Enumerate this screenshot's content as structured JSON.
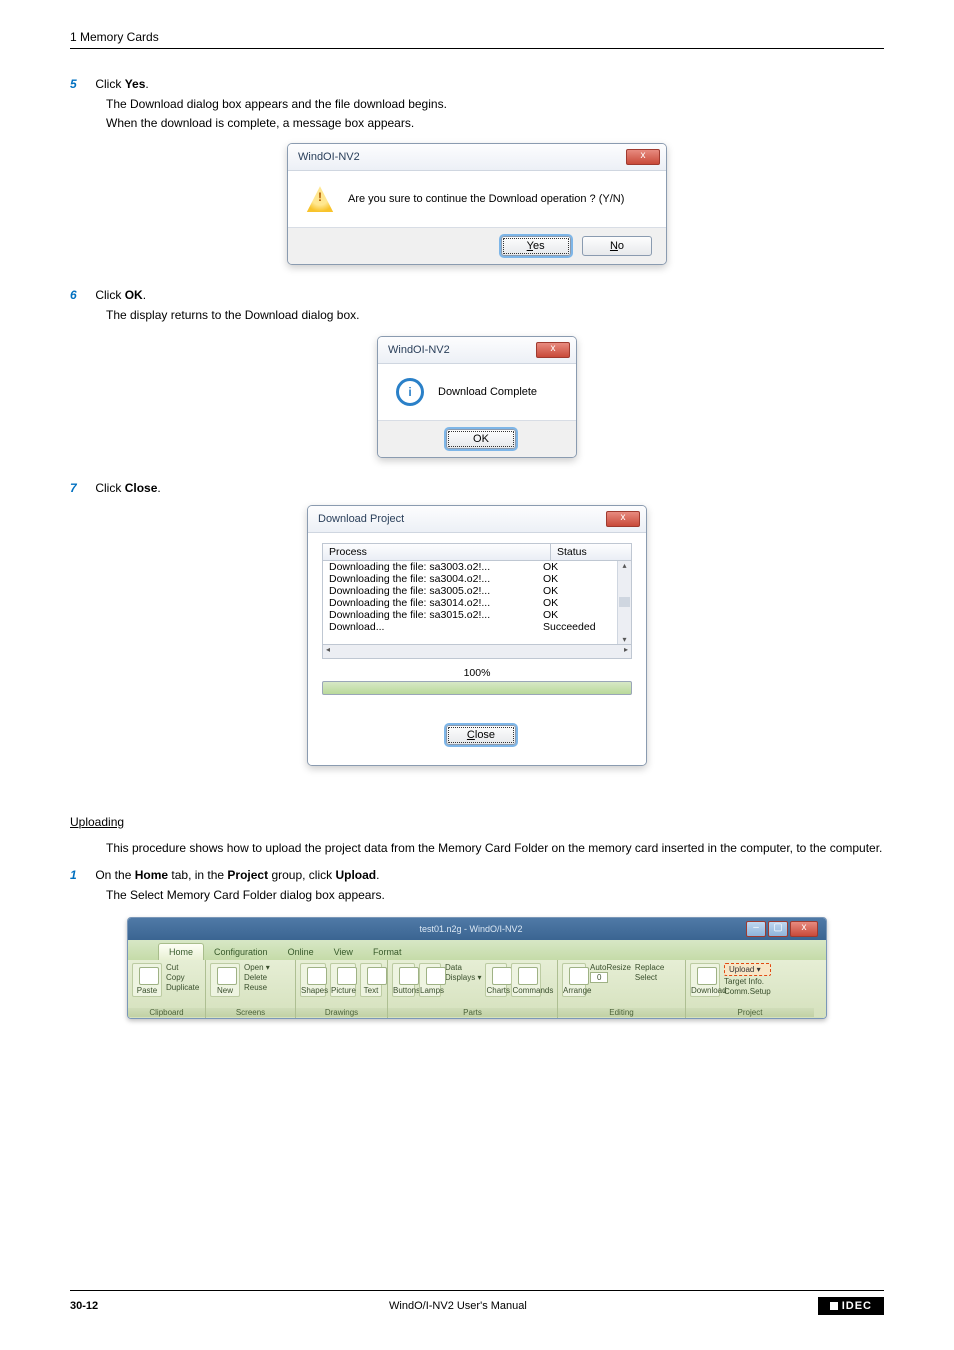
{
  "header": {
    "section": "1 Memory Cards"
  },
  "step5": {
    "num": "5",
    "text_prefix": "Click ",
    "text_bold": "Yes",
    "text_suffix": ".",
    "desc1": "The Download dialog box appears and the file download begins.",
    "desc2": "When the download is complete, a message box appears."
  },
  "dlg1": {
    "title": "WindOI-NV2",
    "msg": "Are you sure to continue the Download operation ? (Y/N)",
    "yes_u": "Y",
    "yes_rest": "es",
    "no_u": "N",
    "no_rest": "o"
  },
  "step6": {
    "num": "6",
    "text_prefix": "Click ",
    "text_bold": "OK",
    "text_suffix": ".",
    "desc1": "The display returns to the Download dialog box."
  },
  "dlg2": {
    "title": "WindOI-NV2",
    "msg": "Download Complete",
    "ok": "OK"
  },
  "step7": {
    "num": "7",
    "text_prefix": "Click ",
    "text_bold": "Close",
    "text_suffix": "."
  },
  "dlg3": {
    "title": "Download Project",
    "col_process": "Process",
    "col_status": "Status",
    "rows": [
      {
        "p": "Downloading the file: sa3003.o2!...",
        "s": "OK"
      },
      {
        "p": "Downloading the file: sa3004.o2!...",
        "s": "OK"
      },
      {
        "p": "Downloading the file: sa3005.o2!...",
        "s": "OK"
      },
      {
        "p": "Downloading the file: sa3014.o2!...",
        "s": "OK"
      },
      {
        "p": "Downloading the file: sa3015.o2!...",
        "s": "OK"
      },
      {
        "p": "Download...",
        "s": "Succeeded"
      }
    ],
    "pct": "100%",
    "close_u": "C",
    "close_rest": "lose"
  },
  "upload": {
    "heading": "Uploading",
    "intro": "This procedure shows how to upload the project data from the Memory Card Folder on the memory card inserted in the computer, to the computer.",
    "step1_num": "1",
    "step1_a": "On the ",
    "step1_b": "Home",
    "step1_c": " tab, in the ",
    "step1_d": "Project",
    "step1_e": " group, click ",
    "step1_f": "Upload",
    "step1_g": ".",
    "step1_desc": "The Select Memory Card Folder dialog box appears."
  },
  "ribbon": {
    "wintitle": "test01.n2g - WindO/I-NV2",
    "tabs": {
      "home": "Home",
      "config": "Configuration",
      "online": "Online",
      "view": "View",
      "format": "Format"
    },
    "groups": {
      "clipboard": "Clipboard",
      "screens": "Screens",
      "drawings": "Drawings",
      "parts": "Parts",
      "editing": "Editing",
      "project": "Project"
    },
    "items": {
      "paste": "Paste",
      "cut": "Cut",
      "copy": "Copy",
      "duplicate": "Duplicate",
      "new": "New",
      "open": "Open ▾",
      "delete": "Delete",
      "reuse": "Reuse",
      "shapes": "Shapes",
      "picture": "Picture",
      "text": "Text",
      "buttons": "Buttons",
      "lamps": "Lamps",
      "data": "Data",
      "displays": "Displays ▾",
      "charts": "Charts",
      "commands": "Commands",
      "arrange": "Arrange",
      "autoresize": "AutoResize",
      "zeroct": "0",
      "replace": "Replace",
      "select": "Select",
      "download": "Download",
      "upload": "Upload ▾",
      "target": "Target Info.",
      "comm": "Comm.Setup"
    }
  },
  "footer": {
    "page": "30-12",
    "manual": "WindO/I-NV2 User's Manual",
    "brand": "IDEC"
  }
}
